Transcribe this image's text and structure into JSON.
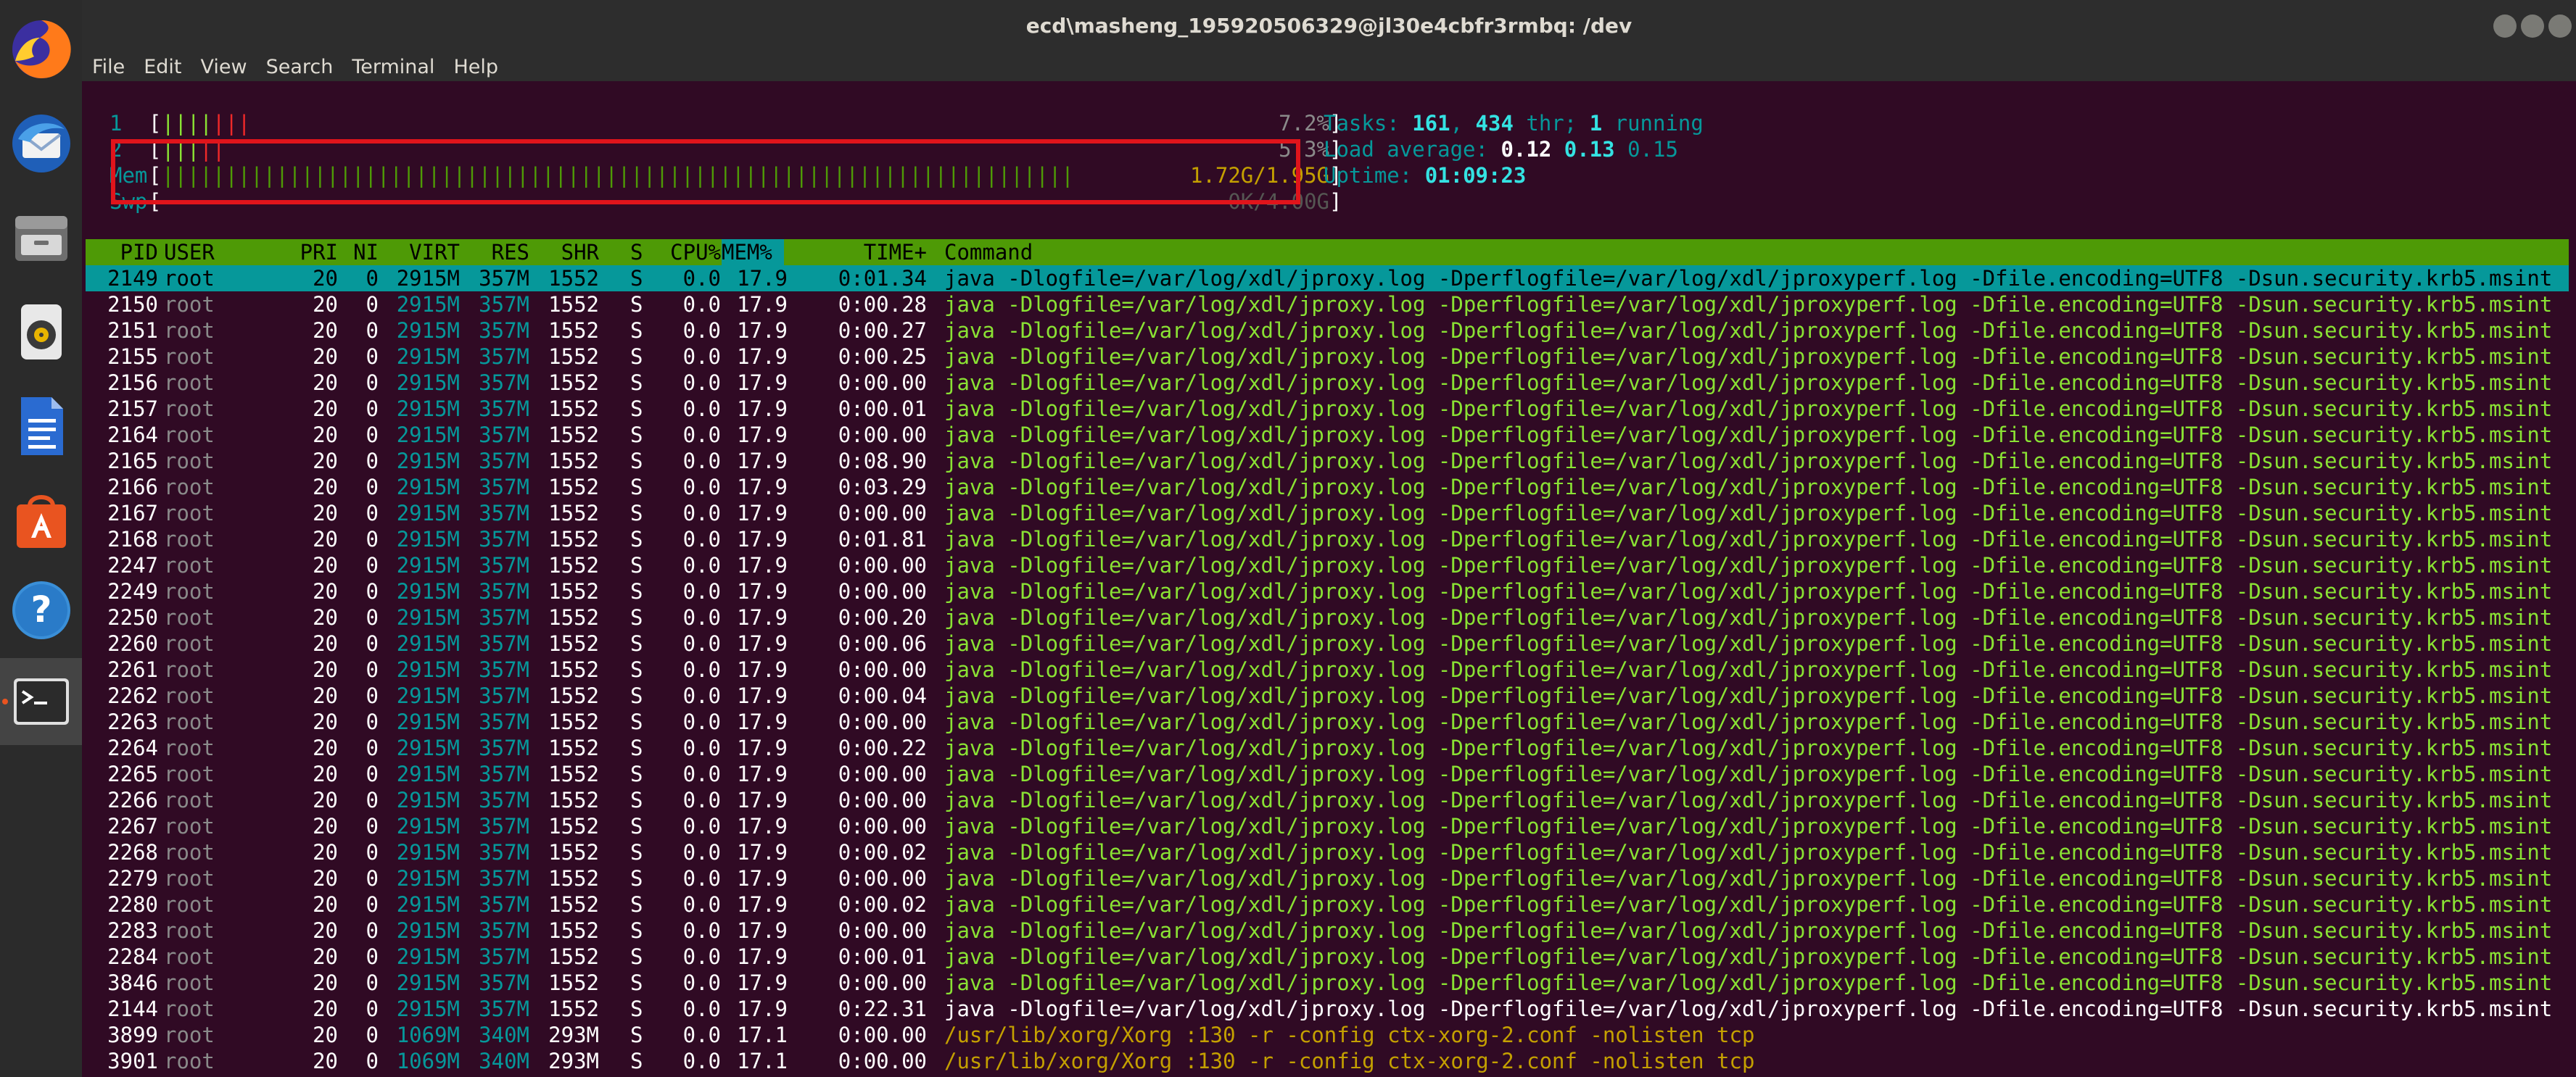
{
  "window": {
    "title": "ecd\\masheng_195920506329@jl30e4cbfr3rmbq: /dev"
  },
  "menu": [
    "File",
    "Edit",
    "View",
    "Search",
    "Terminal",
    "Help"
  ],
  "dock": [
    "firefox-icon",
    "thunderbird-icon",
    "files-icon",
    "rhythmbox-icon",
    "writer-icon",
    "software-center-icon",
    "help-icon",
    "terminal-icon"
  ],
  "meters": {
    "cpu1": {
      "label": "1",
      "value": "7.2%",
      "fraction": 0.072
    },
    "cpu2": {
      "label": "2",
      "value": "5.3%",
      "fraction": 0.053
    },
    "mem": {
      "label": "Mem",
      "value": "1.72G/1.95G",
      "fraction": 0.88
    },
    "swp": {
      "label": "Swp",
      "value": "0K/4.00G",
      "fraction": 0
    }
  },
  "summary": {
    "tasks_label": "Tasks: ",
    "tasks": "161",
    "tasks_sep": ", ",
    "threads": "434",
    "threads_label": " thr; ",
    "running": "1",
    "running_label": " running",
    "load_label": "Load average: ",
    "load1": "0.12",
    "load5": "0.13",
    "load15": "0.15",
    "uptime_label": "Uptime: ",
    "uptime": "01:09:23"
  },
  "columns": {
    "pid": "PID",
    "user": "USER",
    "pri": "PRI",
    "ni": "NI",
    "virt": "VIRT",
    "res": "RES",
    "shr": "SHR",
    "s": "S",
    "cpu": "CPU%",
    "mem": "MEM%",
    "time": "TIME+",
    "command": "Command"
  },
  "java_cmd": "java -Dlogfile=/var/log/xdl/jproxy.log -Dperflogfile=/var/log/xdl/jproxyperf.log -Dfile.encoding=UTF8 -Dsun.security.krb5.msint",
  "xorg_cmd": "/usr/lib/xorg/Xorg :130 -r -config ctx-xorg-2.conf -nolisten tcp",
  "processes": [
    {
      "pid": "2149",
      "user": "root",
      "pri": "20",
      "ni": "0",
      "virt": "2915M",
      "res": "357M",
      "shr": "1552",
      "s": "S",
      "cpu": "0.0",
      "mem": "17.9",
      "time": "0:01.34",
      "cmd": "java",
      "selected": true
    },
    {
      "pid": "2150",
      "user": "root",
      "pri": "20",
      "ni": "0",
      "virt": "2915M",
      "res": "357M",
      "shr": "1552",
      "s": "S",
      "cpu": "0.0",
      "mem": "17.9",
      "time": "0:00.28",
      "cmd": "java"
    },
    {
      "pid": "2151",
      "user": "root",
      "pri": "20",
      "ni": "0",
      "virt": "2915M",
      "res": "357M",
      "shr": "1552",
      "s": "S",
      "cpu": "0.0",
      "mem": "17.9",
      "time": "0:00.27",
      "cmd": "java"
    },
    {
      "pid": "2155",
      "user": "root",
      "pri": "20",
      "ni": "0",
      "virt": "2915M",
      "res": "357M",
      "shr": "1552",
      "s": "S",
      "cpu": "0.0",
      "mem": "17.9",
      "time": "0:00.25",
      "cmd": "java"
    },
    {
      "pid": "2156",
      "user": "root",
      "pri": "20",
      "ni": "0",
      "virt": "2915M",
      "res": "357M",
      "shr": "1552",
      "s": "S",
      "cpu": "0.0",
      "mem": "17.9",
      "time": "0:00.00",
      "cmd": "java"
    },
    {
      "pid": "2157",
      "user": "root",
      "pri": "20",
      "ni": "0",
      "virt": "2915M",
      "res": "357M",
      "shr": "1552",
      "s": "S",
      "cpu": "0.0",
      "mem": "17.9",
      "time": "0:00.01",
      "cmd": "java"
    },
    {
      "pid": "2164",
      "user": "root",
      "pri": "20",
      "ni": "0",
      "virt": "2915M",
      "res": "357M",
      "shr": "1552",
      "s": "S",
      "cpu": "0.0",
      "mem": "17.9",
      "time": "0:00.00",
      "cmd": "java"
    },
    {
      "pid": "2165",
      "user": "root",
      "pri": "20",
      "ni": "0",
      "virt": "2915M",
      "res": "357M",
      "shr": "1552",
      "s": "S",
      "cpu": "0.0",
      "mem": "17.9",
      "time": "0:08.90",
      "cmd": "java"
    },
    {
      "pid": "2166",
      "user": "root",
      "pri": "20",
      "ni": "0",
      "virt": "2915M",
      "res": "357M",
      "shr": "1552",
      "s": "S",
      "cpu": "0.0",
      "mem": "17.9",
      "time": "0:03.29",
      "cmd": "java"
    },
    {
      "pid": "2167",
      "user": "root",
      "pri": "20",
      "ni": "0",
      "virt": "2915M",
      "res": "357M",
      "shr": "1552",
      "s": "S",
      "cpu": "0.0",
      "mem": "17.9",
      "time": "0:00.00",
      "cmd": "java"
    },
    {
      "pid": "2168",
      "user": "root",
      "pri": "20",
      "ni": "0",
      "virt": "2915M",
      "res": "357M",
      "shr": "1552",
      "s": "S",
      "cpu": "0.0",
      "mem": "17.9",
      "time": "0:01.81",
      "cmd": "java"
    },
    {
      "pid": "2247",
      "user": "root",
      "pri": "20",
      "ni": "0",
      "virt": "2915M",
      "res": "357M",
      "shr": "1552",
      "s": "S",
      "cpu": "0.0",
      "mem": "17.9",
      "time": "0:00.00",
      "cmd": "java"
    },
    {
      "pid": "2249",
      "user": "root",
      "pri": "20",
      "ni": "0",
      "virt": "2915M",
      "res": "357M",
      "shr": "1552",
      "s": "S",
      "cpu": "0.0",
      "mem": "17.9",
      "time": "0:00.00",
      "cmd": "java"
    },
    {
      "pid": "2250",
      "user": "root",
      "pri": "20",
      "ni": "0",
      "virt": "2915M",
      "res": "357M",
      "shr": "1552",
      "s": "S",
      "cpu": "0.0",
      "mem": "17.9",
      "time": "0:00.20",
      "cmd": "java"
    },
    {
      "pid": "2260",
      "user": "root",
      "pri": "20",
      "ni": "0",
      "virt": "2915M",
      "res": "357M",
      "shr": "1552",
      "s": "S",
      "cpu": "0.0",
      "mem": "17.9",
      "time": "0:00.06",
      "cmd": "java"
    },
    {
      "pid": "2261",
      "user": "root",
      "pri": "20",
      "ni": "0",
      "virt": "2915M",
      "res": "357M",
      "shr": "1552",
      "s": "S",
      "cpu": "0.0",
      "mem": "17.9",
      "time": "0:00.00",
      "cmd": "java"
    },
    {
      "pid": "2262",
      "user": "root",
      "pri": "20",
      "ni": "0",
      "virt": "2915M",
      "res": "357M",
      "shr": "1552",
      "s": "S",
      "cpu": "0.0",
      "mem": "17.9",
      "time": "0:00.04",
      "cmd": "java"
    },
    {
      "pid": "2263",
      "user": "root",
      "pri": "20",
      "ni": "0",
      "virt": "2915M",
      "res": "357M",
      "shr": "1552",
      "s": "S",
      "cpu": "0.0",
      "mem": "17.9",
      "time": "0:00.00",
      "cmd": "java"
    },
    {
      "pid": "2264",
      "user": "root",
      "pri": "20",
      "ni": "0",
      "virt": "2915M",
      "res": "357M",
      "shr": "1552",
      "s": "S",
      "cpu": "0.0",
      "mem": "17.9",
      "time": "0:00.22",
      "cmd": "java"
    },
    {
      "pid": "2265",
      "user": "root",
      "pri": "20",
      "ni": "0",
      "virt": "2915M",
      "res": "357M",
      "shr": "1552",
      "s": "S",
      "cpu": "0.0",
      "mem": "17.9",
      "time": "0:00.00",
      "cmd": "java"
    },
    {
      "pid": "2266",
      "user": "root",
      "pri": "20",
      "ni": "0",
      "virt": "2915M",
      "res": "357M",
      "shr": "1552",
      "s": "S",
      "cpu": "0.0",
      "mem": "17.9",
      "time": "0:00.00",
      "cmd": "java"
    },
    {
      "pid": "2267",
      "user": "root",
      "pri": "20",
      "ni": "0",
      "virt": "2915M",
      "res": "357M",
      "shr": "1552",
      "s": "S",
      "cpu": "0.0",
      "mem": "17.9",
      "time": "0:00.00",
      "cmd": "java"
    },
    {
      "pid": "2268",
      "user": "root",
      "pri": "20",
      "ni": "0",
      "virt": "2915M",
      "res": "357M",
      "shr": "1552",
      "s": "S",
      "cpu": "0.0",
      "mem": "17.9",
      "time": "0:00.02",
      "cmd": "java"
    },
    {
      "pid": "2279",
      "user": "root",
      "pri": "20",
      "ni": "0",
      "virt": "2915M",
      "res": "357M",
      "shr": "1552",
      "s": "S",
      "cpu": "0.0",
      "mem": "17.9",
      "time": "0:00.00",
      "cmd": "java"
    },
    {
      "pid": "2280",
      "user": "root",
      "pri": "20",
      "ni": "0",
      "virt": "2915M",
      "res": "357M",
      "shr": "1552",
      "s": "S",
      "cpu": "0.0",
      "mem": "17.9",
      "time": "0:00.02",
      "cmd": "java"
    },
    {
      "pid": "2283",
      "user": "root",
      "pri": "20",
      "ni": "0",
      "virt": "2915M",
      "res": "357M",
      "shr": "1552",
      "s": "S",
      "cpu": "0.0",
      "mem": "17.9",
      "time": "0:00.00",
      "cmd": "java"
    },
    {
      "pid": "2284",
      "user": "root",
      "pri": "20",
      "ni": "0",
      "virt": "2915M",
      "res": "357M",
      "shr": "1552",
      "s": "S",
      "cpu": "0.0",
      "mem": "17.9",
      "time": "0:00.01",
      "cmd": "java"
    },
    {
      "pid": "3846",
      "user": "root",
      "pri": "20",
      "ni": "0",
      "virt": "2915M",
      "res": "357M",
      "shr": "1552",
      "s": "S",
      "cpu": "0.0",
      "mem": "17.9",
      "time": "0:00.00",
      "cmd": "java"
    },
    {
      "pid": "2144",
      "user": "root",
      "pri": "20",
      "ni": "0",
      "virt": "2915M",
      "res": "357M",
      "shr": "1552",
      "s": "S",
      "cpu": "0.0",
      "mem": "17.9",
      "time": "0:22.31",
      "cmd": "java",
      "main": true
    },
    {
      "pid": "3899",
      "user": "root",
      "pri": "20",
      "ni": "0",
      "virt": "1069M",
      "res": "340M",
      "shr": "293M",
      "s": "S",
      "cpu": "0.0",
      "mem": "17.1",
      "time": "0:00.00",
      "cmd": "xorg"
    },
    {
      "pid": "3901",
      "user": "root",
      "pri": "20",
      "ni": "0",
      "virt": "1069M",
      "res": "340M",
      "shr": "293M",
      "s": "S",
      "cpu": "0.0",
      "mem": "17.1",
      "time": "0:00.00",
      "cmd": "xorg"
    }
  ]
}
